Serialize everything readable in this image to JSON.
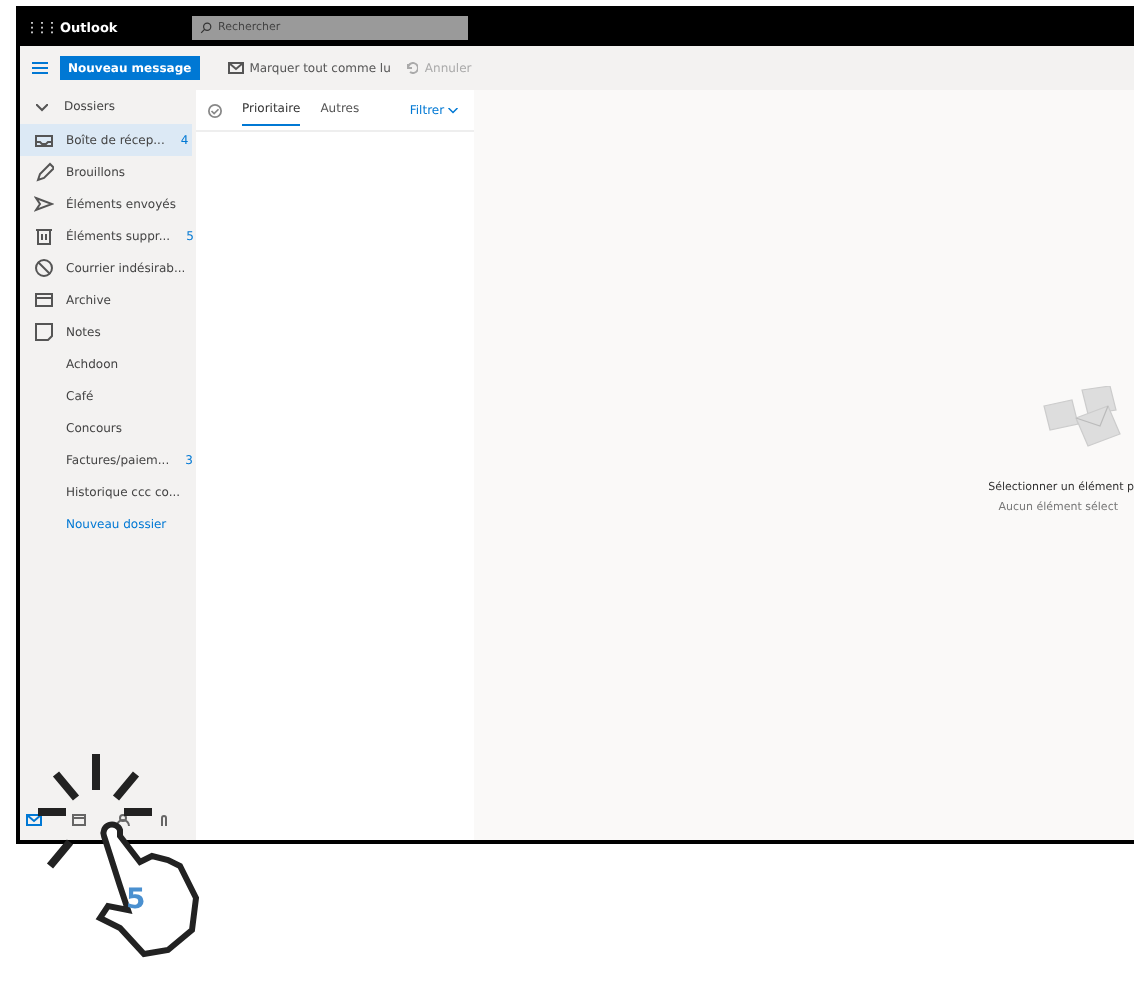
{
  "app": {
    "launcher": "⋮⋮⋮",
    "title": "Outlook"
  },
  "search": {
    "placeholder": "Rechercher"
  },
  "commands": {
    "new_message": "Nouveau message",
    "mark_all_read": "Marquer tout comme lu",
    "undo": "Annuler"
  },
  "folders_header": "Dossiers",
  "folders": [
    {
      "label": "Boîte de récep...",
      "count": "4",
      "selected": true,
      "kind": "folder"
    },
    {
      "label": "Brouillons",
      "selected": false,
      "kind": "folder"
    },
    {
      "label": "Éléments envoyés",
      "selected": false,
      "kind": "folder"
    },
    {
      "label": "Éléments suppr...",
      "count": "5",
      "selected": false,
      "kind": "folder"
    },
    {
      "label": "Courrier indésirab...",
      "selected": false,
      "kind": "folder"
    },
    {
      "label": "Archive",
      "selected": false,
      "kind": "folder"
    },
    {
      "label": "Notes",
      "selected": false,
      "kind": "folder"
    },
    {
      "label": "Achdoon",
      "selected": false,
      "kind": "folder"
    },
    {
      "label": "Café",
      "selected": false,
      "kind": "folder"
    },
    {
      "label": "Concours",
      "selected": false,
      "kind": "folder"
    },
    {
      "label": "Factures/paiem...",
      "count": "3",
      "selected": false,
      "kind": "folder"
    },
    {
      "label": "Historique ccc co...",
      "selected": false,
      "kind": "folder"
    },
    {
      "label": "Nouveau dossier",
      "selected": false,
      "kind": "action"
    }
  ],
  "tabs": [
    {
      "label": "Prioritaire",
      "selected": true
    },
    {
      "label": "Autres",
      "selected": false
    }
  ],
  "filter": "Filtrer",
  "reading_pane": {
    "title": "Sélectionner un élément p",
    "subtitle": "Aucun élément sélect"
  },
  "tutorial": {
    "step": "5"
  }
}
